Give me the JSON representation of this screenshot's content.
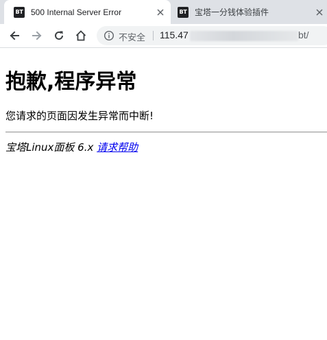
{
  "tabs": [
    {
      "favicon_text": "BT",
      "title": "500 Internal Server Error",
      "active": true
    },
    {
      "favicon_text": "BT",
      "title": "宝塔一分钱体验插件",
      "active": false
    }
  ],
  "toolbar": {
    "back_icon": "arrow-left-icon",
    "forward_icon": "arrow-right-icon",
    "reload_icon": "reload-icon",
    "home_icon": "home-icon"
  },
  "address_bar": {
    "security_icon": "info-icon",
    "security_label": "不安全",
    "url_host": "115.47",
    "url_path": "bt/"
  },
  "page": {
    "title": "抱歉,程序异常",
    "message": "您请求的页面因发生异常而中断!",
    "footer_text": "宝塔Linux面板 6.x",
    "help_link": "请求帮助"
  },
  "colors": {
    "tab_strip": "#dee1e6",
    "omnibox": "#f1f3f4",
    "link": "#0000ee"
  }
}
